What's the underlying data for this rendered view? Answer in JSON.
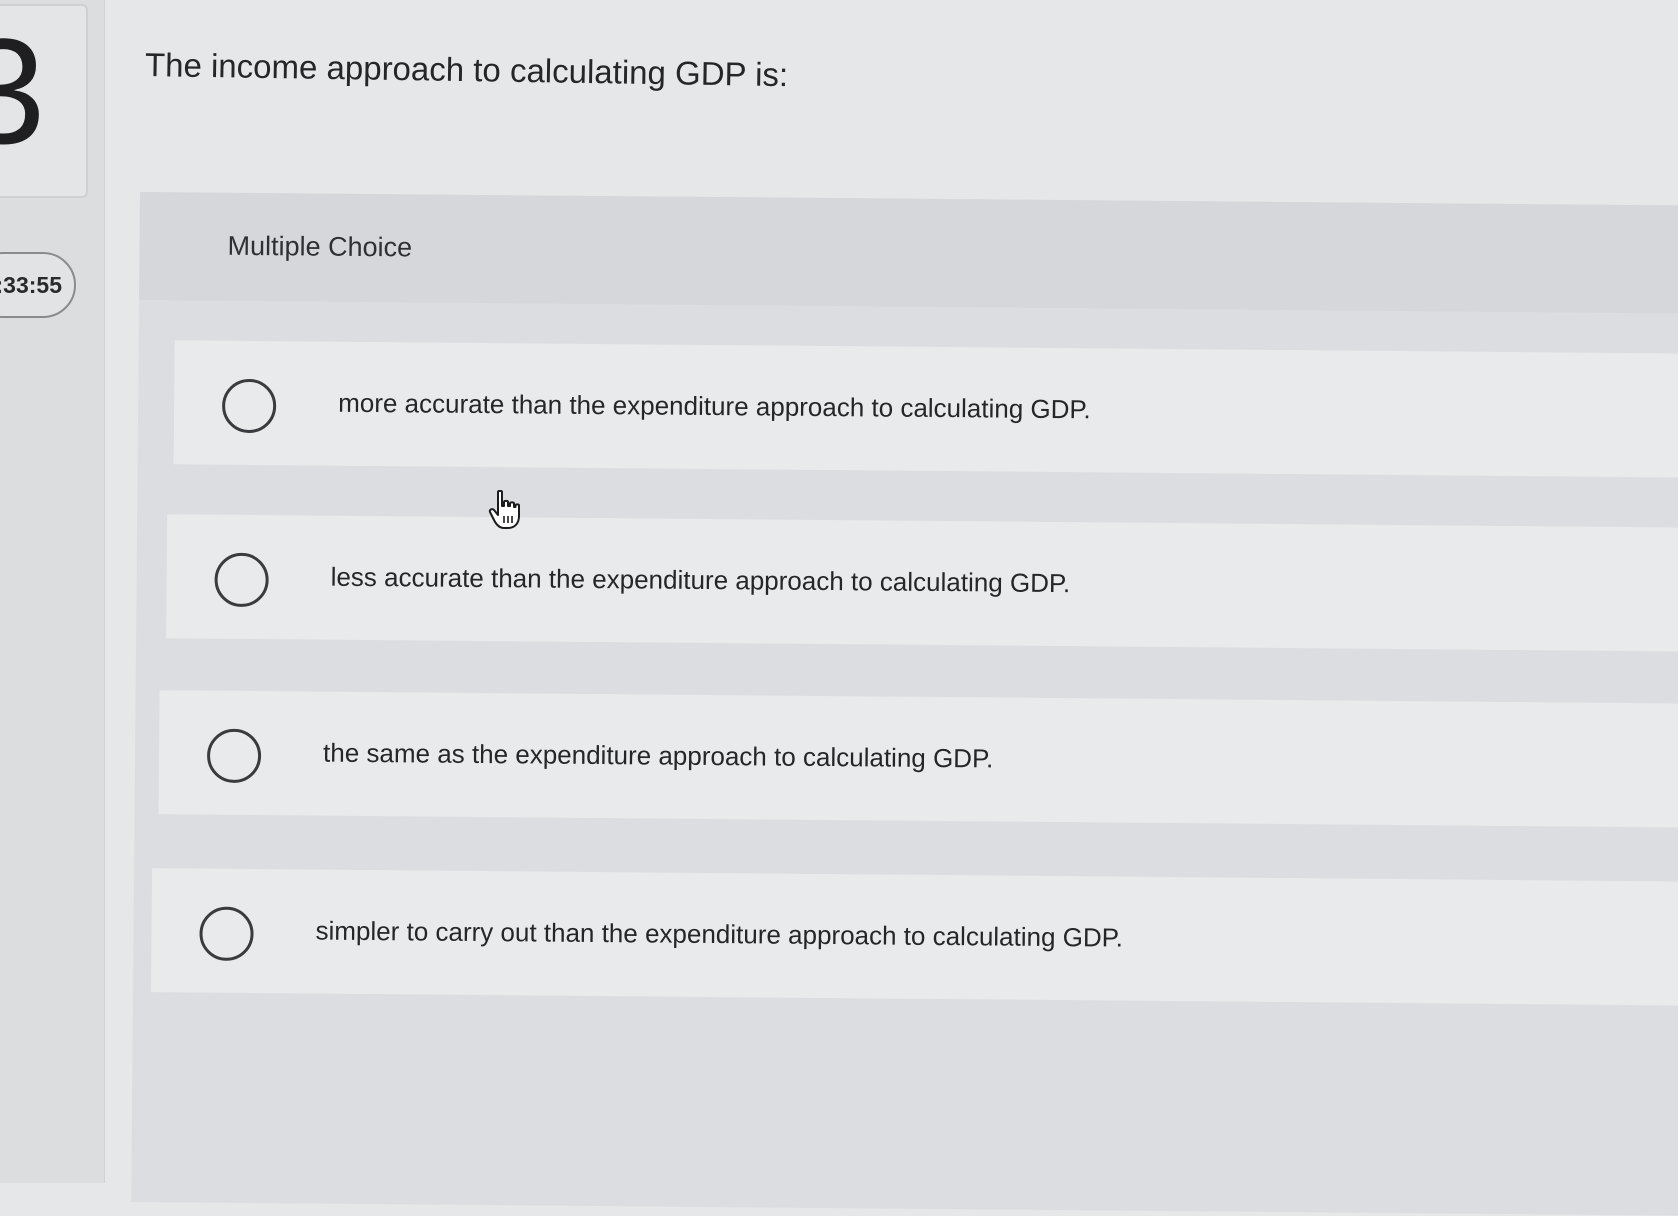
{
  "sidebar": {
    "question_number": "3",
    "timer": ":33:55"
  },
  "question": {
    "text": "The income approach to calculating GDP is:"
  },
  "choices": {
    "header": "Multiple Choice",
    "options": [
      {
        "label": "more accurate than the expenditure approach to calculating GDP.",
        "selected": false
      },
      {
        "label": "less accurate than the expenditure approach to calculating GDP.",
        "selected": false
      },
      {
        "label": "the same as the expenditure approach to calculating GDP.",
        "selected": false
      },
      {
        "label": "simpler to carry out than the expenditure approach to calculating GDP.",
        "selected": false
      }
    ]
  },
  "cursor": {
    "icon": "hand-pointer-icon"
  }
}
